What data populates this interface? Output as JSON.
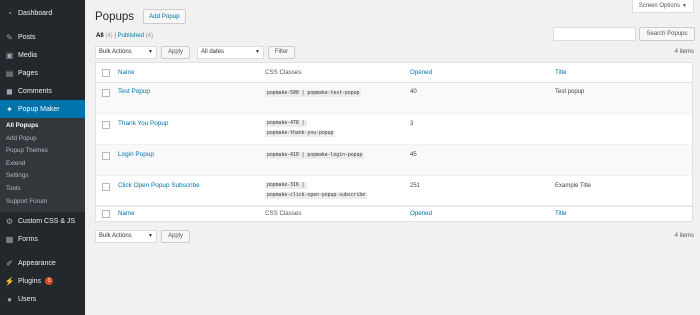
{
  "sidebar": {
    "items": [
      {
        "label": "Dashboard",
        "icon": "dashboard-icon"
      },
      {
        "label": "Posts",
        "icon": "pin-icon"
      },
      {
        "label": "Media",
        "icon": "media-icon"
      },
      {
        "label": "Pages",
        "icon": "pages-icon"
      },
      {
        "label": "Comments",
        "icon": "comments-icon"
      },
      {
        "label": "Popup Maker",
        "icon": "popup-maker-icon"
      }
    ],
    "submenu": [
      "All Popups",
      "Add Popup",
      "Popup Themes",
      "Extend",
      "Settings",
      "Tools",
      "Support Forum"
    ],
    "bottom_items": [
      {
        "label": "Custom CSS & JS",
        "icon": "css-icon"
      },
      {
        "label": "Forms",
        "icon": "forms-icon"
      },
      {
        "label": "Appearance",
        "icon": "appearance-icon"
      },
      {
        "label": "Plugins",
        "icon": "plugins-icon",
        "badge": "3"
      },
      {
        "label": "Users",
        "icon": "users-icon"
      }
    ]
  },
  "header": {
    "title": "Popups",
    "add_button": "Add Popup",
    "screen_options": "Screen Options"
  },
  "filters": {
    "all_label": "All",
    "all_count": "(4)",
    "separator": "|",
    "published_label": "Published",
    "published_count": "(4)",
    "search_button": "Search Popups",
    "bulk_actions": "Bulk Actions",
    "apply": "Apply",
    "dates": "All dates",
    "filter": "Filter",
    "items_count": "4 items"
  },
  "table": {
    "columns": [
      "Name",
      "CSS Classes",
      "Opened",
      "Title"
    ],
    "rows": [
      {
        "name": "Test Popup",
        "css": [
          "popmake-500 | popmake-test-popup"
        ],
        "opened": "40",
        "title": "Test popup"
      },
      {
        "name": "Thank You Popup",
        "css": [
          "popmake-478 |",
          "popmake-thank-you-popup"
        ],
        "opened": "3",
        "title": ""
      },
      {
        "name": "Login Popup",
        "css": [
          "popmake-410 | popmake-login-popup"
        ],
        "opened": "45",
        "title": ""
      },
      {
        "name": "Click Open Popup Subscribe",
        "css": [
          "popmake-316 |",
          "popmake-click-open-popup-subscribe"
        ],
        "opened": "251",
        "title": "Example Title"
      }
    ]
  },
  "colors": {
    "sidebar": "#23282d",
    "accent": "#0073aa",
    "submenu": "#32373c"
  }
}
